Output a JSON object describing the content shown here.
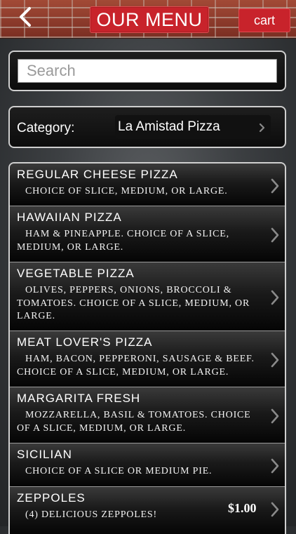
{
  "header": {
    "title": "OUR MENU",
    "cart_label": "cart"
  },
  "search": {
    "placeholder": "Search",
    "value": ""
  },
  "category": {
    "label": "Category:",
    "selected": "La Amistad Pizza"
  },
  "menu_items": [
    {
      "name": "REGULAR CHEESE PIZZA",
      "description": "CHOICE OF SLICE, MEDIUM, OR LARGE.",
      "price": ""
    },
    {
      "name": "HAWAIIAN PIZZA",
      "description": "HAM & PINEAPPLE. CHOICE OF A SLICE, MEDIUM, OR LARGE.",
      "price": ""
    },
    {
      "name": "VEGETABLE PIZZA",
      "description": "OLIVES, PEPPERS, ONIONS, BROCCOLI & TOMATOES. CHOICE OF A SLICE, MEDIUM, OR LARGE.",
      "price": ""
    },
    {
      "name": "MEAT LOVER'S PIZZA",
      "description": "HAM, BACON, PEPPERONI, SAUSAGE & BEEF. CHOICE OF A SLICE, MEDIUM, OR LARGE.",
      "price": ""
    },
    {
      "name": "MARGARITA FRESH",
      "description": "MOZZARELLA, BASIL & TOMATOES. CHOICE OF A SLICE, MEDIUM, OR LARGE.",
      "price": ""
    },
    {
      "name": "SICILIAN",
      "description": "CHOICE OF A SLICE OR MEDIUM PIE.",
      "price": ""
    },
    {
      "name": "ZEPPOLES",
      "description": "(4) DELICIOUS ZEPPOLES!",
      "price": "$1.00"
    }
  ],
  "icons": {
    "back": "chevron-left-icon",
    "row_arrow": "chevron-right-icon"
  },
  "colors": {
    "accent_red": "#c8232b",
    "brick": "#8e3a2a",
    "panel_bg": "#0c0c0c",
    "panel_border": "#cfcfcf"
  }
}
